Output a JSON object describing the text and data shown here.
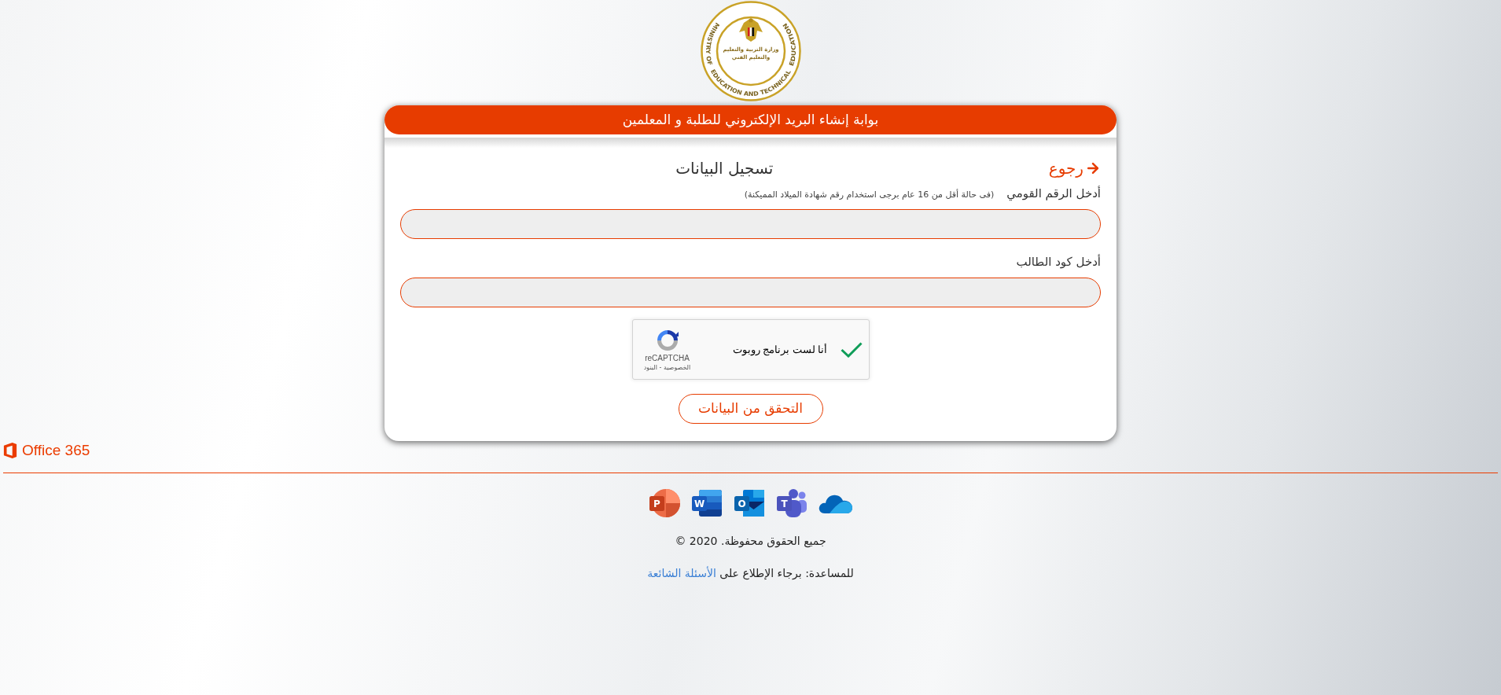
{
  "logo": {
    "english_parts": [
      "MINISTRY OF",
      "EDUCATION AND TECHNICAL",
      "EDUCATION"
    ],
    "arabic_lines": [
      "وزارة التربية والتعليم",
      "والتعليم الفني"
    ]
  },
  "card": {
    "header": "بوابة إنشاء البريد الإلكتروني للطلبة و المعلمين",
    "back_link": "رجوع",
    "title": "تسجيل البيانات",
    "fields": [
      {
        "label": "أدخل الرقم القومي",
        "hint": "(فى حالة أقل من 16 عام برجى استخدام رقم شهادة الميلاد المميكنة)"
      },
      {
        "label": "أدخل كود الطالب"
      }
    ],
    "recaptcha": {
      "checked": true,
      "label": "أنا لست برنامج روبوت",
      "brand": "reCAPTCHA",
      "links": "الخصوصية - البنود"
    },
    "submit_button": "التحقق من البيانات"
  },
  "office_logo": {
    "text": "Office 365"
  },
  "app_icons": [
    {
      "kind": "cloud"
    },
    {
      "kind": "chat",
      "letter": "T"
    },
    {
      "kind": "mail",
      "letter": "O"
    },
    {
      "kind": "document",
      "letter": "W"
    },
    {
      "kind": "presentation",
      "letter": "P"
    }
  ],
  "footer": {
    "copyright": "جميع الحقوق محفوظة. 2020 ©",
    "help_text": "للمساعدة: برجاء الإطلاع على",
    "help_link": "الأسئلة الشائعة"
  }
}
